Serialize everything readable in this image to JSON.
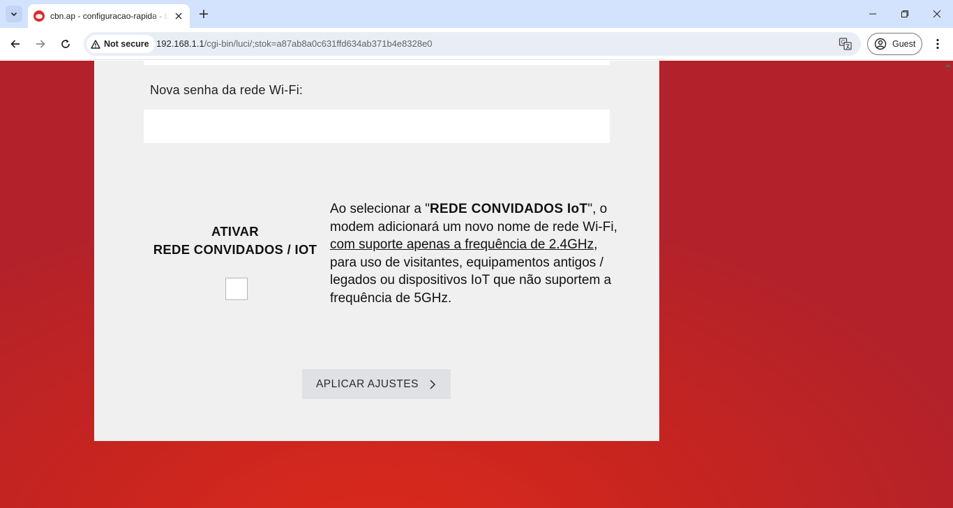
{
  "browser": {
    "tab_title": "cbn.ap - configuracao-rapida - L",
    "security_chip": "Not secure",
    "url_host": "192.168.1.1",
    "url_path": "/cgi-bin/luci/;stok=a87ab8a0c631ffd634ab371b4e8328e0",
    "profile_label": "Guest"
  },
  "icons": {
    "tab_search": "chevron-down-icon",
    "favicon": "cbn-logo-icon",
    "tab_close": "close-icon",
    "new_tab": "plus-icon",
    "minimize": "minimize-icon",
    "restore": "restore-icon",
    "close_window": "close-icon",
    "back": "arrow-left-icon",
    "forward": "arrow-right-icon",
    "reload": "reload-icon",
    "warning": "warning-triangle-icon",
    "translate": "translate-icon",
    "profile": "person-icon",
    "menu": "kebab-menu-icon",
    "apply_chevron": "chevron-right-icon"
  },
  "colors": {
    "accent_background": "#c9251f",
    "panel": "#f0f0f0",
    "button": "#dfe1e4"
  },
  "form": {
    "password_label": "Nova senha da rede Wi-Fi:",
    "password_value": "",
    "guest_title_line1": "ATIVAR",
    "guest_title_line2": "REDE CONVIDADOS / IOT",
    "guest_checked": false,
    "desc_intro": "Ao selecionar a \"",
    "desc_bold": "REDE CONVIDADOS IoT",
    "desc_mid": "\", o modem adicionará um novo nome de rede Wi-Fi, ",
    "desc_underline": "com suporte apenas a frequência de 2.4GHz",
    "desc_end": ", para uso de visitantes, equipamentos antigos / legados ou dispositivos IoT que não suportem a frequência de 5GHz.",
    "apply_label": "APLICAR AJUSTES"
  }
}
